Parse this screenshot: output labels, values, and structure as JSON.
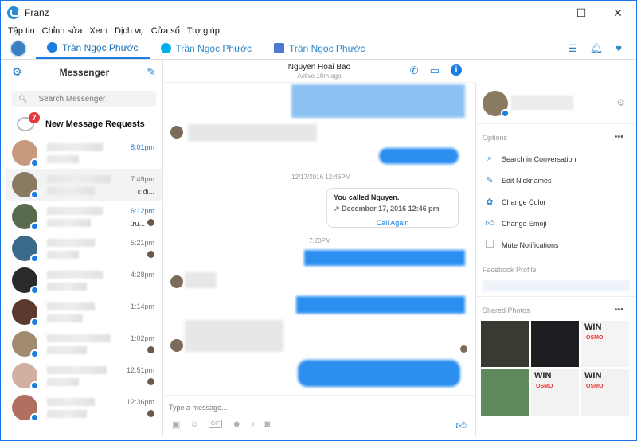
{
  "window": {
    "title": "Franz",
    "minimize": "—",
    "maximize": "☐",
    "close": "✕"
  },
  "menu": [
    "Tập tin",
    "Chỉnh sửa",
    "Xem",
    "Dịch vụ",
    "Cửa sổ",
    "Trợ giúp"
  ],
  "tabs": [
    {
      "label": "Trần Ngọc Phước",
      "service": "messenger",
      "color": "#1a7de0"
    },
    {
      "label": "Trần Ngọc Phước",
      "service": "skype",
      "color": "#00aff0"
    },
    {
      "label": "Trần Ngọc Phước",
      "service": "mail",
      "color": "#4a7bd0"
    }
  ],
  "sidebar": {
    "title": "Messenger",
    "search_placeholder": "Search Messenger",
    "requests_label": "New Message Requests",
    "requests_count": "7",
    "conversations": [
      {
        "time": "8:01pm",
        "unread": true
      },
      {
        "time": "7:49pm",
        "snippet": "c đi..."
      },
      {
        "time": "6:12pm",
        "unread": true,
        "snippet": "ừu..."
      },
      {
        "time": "5:21pm"
      },
      {
        "time": "4:28pm"
      },
      {
        "time": "1:14pm"
      },
      {
        "time": "1:02pm"
      },
      {
        "time": "12:51pm"
      },
      {
        "time": "12:36pm"
      }
    ]
  },
  "chat": {
    "name": "Nguyen Hoai Bao",
    "status": "Active 10m ago",
    "date_stamp": "12/17/2016 12:46PM",
    "time_stamp": "7:20PM",
    "call": {
      "title": "You called Nguyen.",
      "when": "↗ December 17, 2016 12:46 pm",
      "action": "Call Again"
    },
    "composer_placeholder": "Type a message..."
  },
  "info": {
    "options_label": "Options",
    "options": [
      {
        "label": "Search in Conversation",
        "icon": "search-icon"
      },
      {
        "label": "Edit Nicknames",
        "icon": "pencil-icon"
      },
      {
        "label": "Change Color",
        "icon": "palette-icon"
      },
      {
        "label": "Change Emoji",
        "icon": "thumbs-up-icon"
      },
      {
        "label": "Mute Notifications",
        "icon": "checkbox"
      }
    ],
    "facebook_profile_label": "Facebook Profile",
    "shared_photos_label": "Shared Photos",
    "photo_text": "WIN",
    "photo_sub": "OSMO"
  },
  "colors": {
    "accent": "#1a7de0",
    "bubble": "#2b8ff0"
  }
}
